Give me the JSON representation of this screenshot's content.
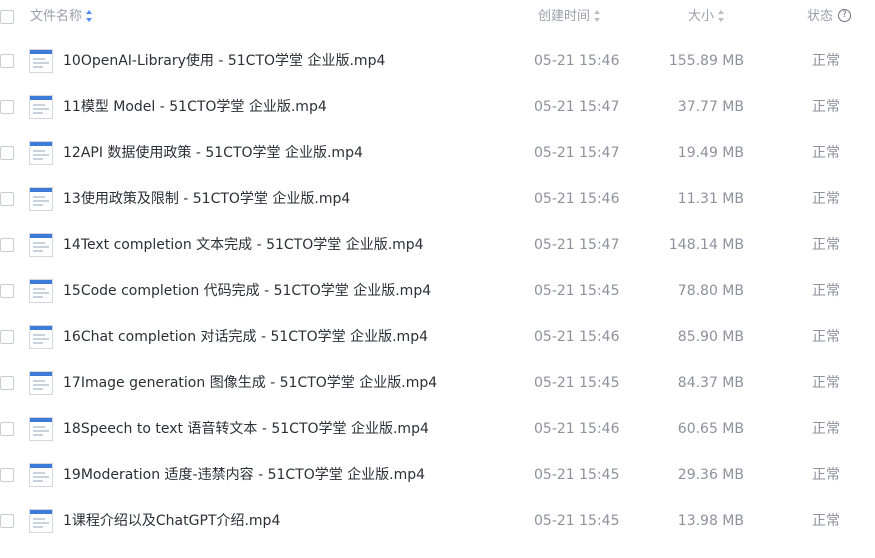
{
  "header": {
    "name": "文件名称",
    "created": "创建时间",
    "size": "大小",
    "status": "状态",
    "help_glyph": "?"
  },
  "files": [
    {
      "name": "10OpenAI-Library使用 - 51CTO学堂 企业版.mp4",
      "time": "05-21 15:46",
      "size": "155.89 MB",
      "status": "正常"
    },
    {
      "name": "11模型 Model - 51CTO学堂 企业版.mp4",
      "time": "05-21 15:47",
      "size": "37.77 MB",
      "status": "正常"
    },
    {
      "name": "12API 数据使用政策 - 51CTO学堂 企业版.mp4",
      "time": "05-21 15:47",
      "size": "19.49 MB",
      "status": "正常"
    },
    {
      "name": "13使用政策及限制 - 51CTO学堂 企业版.mp4",
      "time": "05-21 15:46",
      "size": "11.31 MB",
      "status": "正常"
    },
    {
      "name": "14Text completion 文本完成 - 51CTO学堂 企业版.mp4",
      "time": "05-21 15:47",
      "size": "148.14 MB",
      "status": "正常"
    },
    {
      "name": "15Code completion 代码完成 - 51CTO学堂 企业版.mp4",
      "time": "05-21 15:45",
      "size": "78.80 MB",
      "status": "正常"
    },
    {
      "name": "16Chat completion 对话完成 - 51CTO学堂 企业版.mp4",
      "time": "05-21 15:46",
      "size": "85.90 MB",
      "status": "正常"
    },
    {
      "name": "17Image generation 图像生成 - 51CTO学堂 企业版.mp4",
      "time": "05-21 15:45",
      "size": "84.37 MB",
      "status": "正常"
    },
    {
      "name": "18Speech to text 语音转文本 - 51CTO学堂 企业版.mp4",
      "time": "05-21 15:46",
      "size": "60.65 MB",
      "status": "正常"
    },
    {
      "name": "19Moderation 适度-违禁内容 - 51CTO学堂 企业版.mp4",
      "time": "05-21 15:45",
      "size": "29.36 MB",
      "status": "正常"
    },
    {
      "name": "1课程介绍以及ChatGPT介绍.mp4",
      "time": "05-21 15:45",
      "size": "13.98 MB",
      "status": "正常"
    }
  ]
}
